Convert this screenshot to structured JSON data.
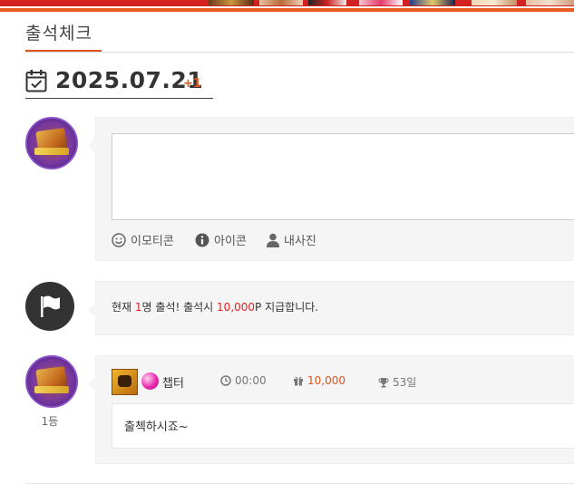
{
  "header": {
    "title": "출석체크"
  },
  "date": {
    "value": "2025.07.21",
    "bonus": "+1"
  },
  "comment_form": {
    "placeholder": "",
    "tools": [
      {
        "label": "이모티콘",
        "icon": "smiley-icon"
      },
      {
        "label": "아이콘",
        "icon": "info-icon"
      },
      {
        "label": "내사진",
        "icon": "user-icon"
      }
    ]
  },
  "notice": {
    "prefix": "현재 ",
    "count": "1",
    "mid": "명 출석! 출석시 ",
    "points": "10,000",
    "suffix": "P 지급합니다."
  },
  "entries": [
    {
      "rank": "1등",
      "nickname": "챕터",
      "time": "00:00",
      "points": "10,000",
      "days": "53일",
      "message": "출첵하시죠~"
    }
  ],
  "colors": {
    "accent": "#e0531c",
    "highlight": "#e02020",
    "banner_red": "#d32121"
  }
}
